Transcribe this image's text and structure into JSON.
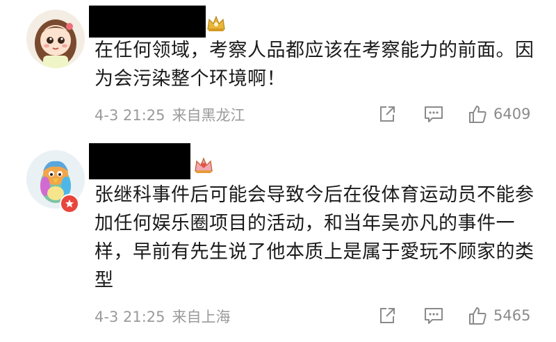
{
  "comments": [
    {
      "text": "在任何领域，考察人品都应该在考察能力的前面。因为会污染整个环境啊！",
      "time": "4-3 21:25",
      "location": "来自黑龙江",
      "likes": "6409",
      "avatar_icon": "cartoon-girl-avatar",
      "vip_icon": "gold-crown-icon"
    },
    {
      "text": "张继科事件后可能会导致今后在役体育运动员不能参加任何娱乐圈项目的活动，和当年吴亦凡的事件一样，早前有先生说了他本质上是属于愛玩不顾家的类型",
      "time": "4-3 21:25",
      "location": "来自上海",
      "likes": "5465",
      "avatar_icon": "rainbow-bird-avatar",
      "vip_icon": "pink-crown-icon"
    }
  ],
  "colors": {
    "text": "#1a1a1a",
    "meta": "#9a9a9a",
    "icon": "#8a8a8a",
    "badge": "#e8453c"
  }
}
